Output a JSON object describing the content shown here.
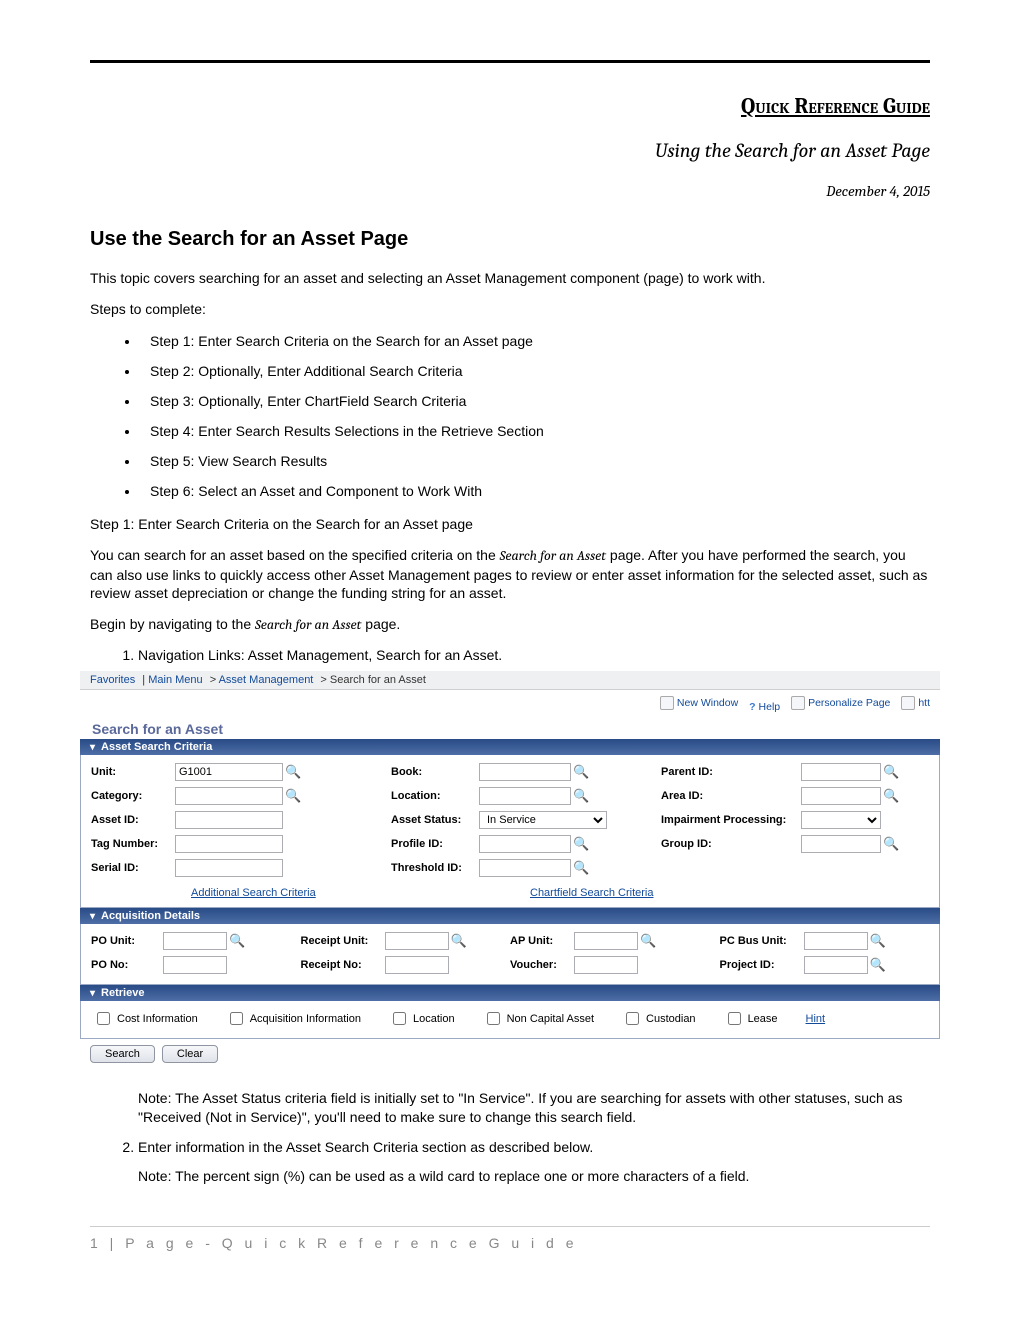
{
  "header": {
    "title": "Quick Reference Guide",
    "subtitle": "Using the Search for an Asset Page",
    "date": "December 4, 2015"
  },
  "section": {
    "heading": "Use the Search for an Asset Page",
    "intro": "This topic covers searching for an asset and selecting an Asset Management component (page) to work with.",
    "steps_label": "Steps to complete:",
    "steps": [
      "Step 1: Enter Search Criteria on the Search for an Asset page",
      "Step 2: Optionally, Enter Additional Search Criteria",
      "Step 3: Optionally, Enter ChartField Search Criteria",
      "Step 4: Enter Search Results Selections in the Retrieve Section",
      "Step 5: View Search Results",
      "Step 6: Select an Asset and Component to Work With"
    ],
    "step1_label": "Step 1: Enter Search Criteria on the Search for an Asset page",
    "p1": "You can search for an asset based on the specified criteria on the ",
    "p1_em": "Search for an Asset",
    "p1_cont": " page. After you have performed the search, you can also use links to quickly access other Asset Management pages to review or enter asset information for the selected asset, such as review asset depreciation or change the funding string for an asset.",
    "p2a": "Begin by navigating to the ",
    "p2_em": "Search for an Asset",
    "p2b": " page.",
    "nav_item": "Navigation Links: Asset Management, Search for an Asset.",
    "note1": "Note: The Asset Status criteria field is initially set to \"In Service\". If you are searching for assets with other statuses, such as \"Received (Not in Service)\", you'll need to make sure to change this search field.",
    "item2": "Enter information in the Asset Search Criteria section as described below.",
    "note2": "Note: The percent sign (%) can be used as a wild card to replace one or more characters of a field."
  },
  "shot": {
    "crumbs": {
      "fav": "Favorites",
      "main": "Main Menu",
      "am": "Asset Management",
      "page": "Search for an Asset"
    },
    "toplinks": {
      "newwin": "New Window",
      "help": "Help",
      "pers": "Personalize Page",
      "htt": "htt"
    },
    "pagetitle": "Search for an Asset",
    "bars": {
      "asset": "Asset Search Criteria",
      "acq": "Acquisition Details",
      "retr": "Retrieve"
    },
    "labels": {
      "unit": "Unit:",
      "category": "Category:",
      "assetid": "Asset ID:",
      "tag": "Tag Number:",
      "serial": "Serial ID:",
      "book": "Book:",
      "location": "Location:",
      "status": "Asset Status:",
      "profile": "Profile ID:",
      "threshold": "Threshold ID:",
      "parent": "Parent ID:",
      "area": "Area ID:",
      "impair": "Impairment Processing:",
      "group": "Group ID:",
      "pounit": "PO Unit:",
      "rcptunit": "Receipt Unit:",
      "apunit": "AP Unit:",
      "pcbus": "PC Bus Unit:",
      "pono": "PO No:",
      "rcptno": "Receipt No:",
      "voucher": "Voucher:",
      "project": "Project ID:"
    },
    "values": {
      "unit": "G1001",
      "status": "In Service"
    },
    "sublinks": {
      "addl": "Additional Search Criteria",
      "cfs": "Chartfield Search Criteria"
    },
    "checks": {
      "cost": "Cost Information",
      "acq": "Acquisition Information",
      "loc": "Location",
      "nca": "Non Capital Asset",
      "cust": "Custodian",
      "lease": "Lease",
      "hint": "Hint"
    },
    "buttons": {
      "search": "Search",
      "clear": "Clear"
    }
  },
  "footer": "1 | P a g e - Q u i c k   R e f e r e n c e   G u i d e"
}
